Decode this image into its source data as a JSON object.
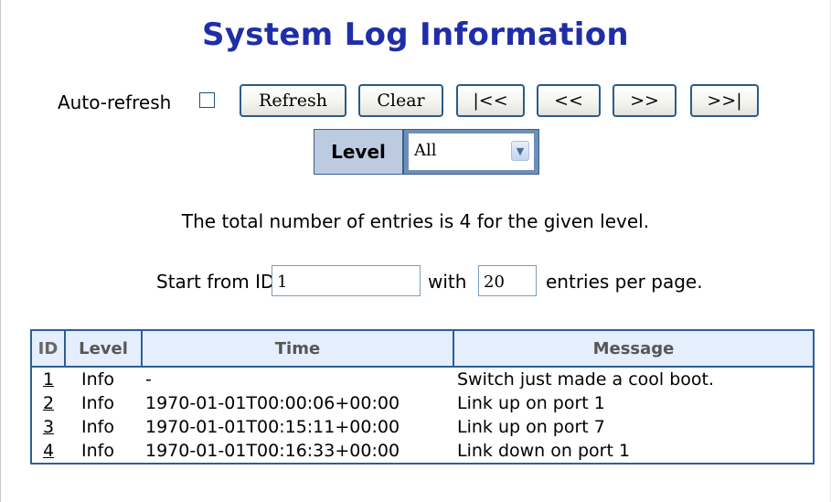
{
  "page": {
    "title": "System Log Information"
  },
  "toolbar": {
    "auto_refresh_label": "Auto-refresh",
    "auto_refresh_checked": false,
    "buttons": {
      "refresh": "Refresh",
      "clear": "Clear",
      "first": "|<<",
      "prev": "<<",
      "next": ">>",
      "last": ">>|"
    }
  },
  "level_filter": {
    "label": "Level",
    "selected": "All"
  },
  "summary": {
    "text": "The total number of entries is 4 for the given level."
  },
  "paging": {
    "start_label": "Start from ID",
    "start_value": "1",
    "with_label": "with",
    "count_value": "20",
    "suffix": "entries per page."
  },
  "table": {
    "headers": {
      "id": "ID",
      "level": "Level",
      "time": "Time",
      "message": "Message"
    },
    "rows": [
      {
        "id": "1",
        "level": "Info",
        "time": "-",
        "message": "Switch just made a cool boot."
      },
      {
        "id": "2",
        "level": "Info",
        "time": "1970-01-01T00:00:06+00:00",
        "message": "Link up on port 1"
      },
      {
        "id": "3",
        "level": "Info",
        "time": "1970-01-01T00:15:11+00:00",
        "message": "Link up on port 7"
      },
      {
        "id": "4",
        "level": "Info",
        "time": "1970-01-01T00:16:33+00:00",
        "message": "Link down on port 1"
      }
    ]
  },
  "colors": {
    "title": "#1f2ea8",
    "border": "#2c5f98",
    "header_bg": "#e5eefc",
    "level_box_bg": "#6f8fb8",
    "level_label_bg": "#bccbe0"
  }
}
